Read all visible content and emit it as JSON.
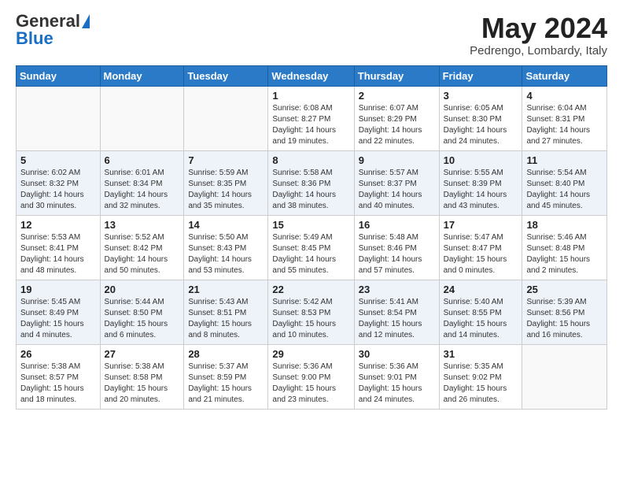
{
  "header": {
    "logo_general": "General",
    "logo_blue": "Blue",
    "month_title": "May 2024",
    "location": "Pedrengo, Lombardy, Italy"
  },
  "weekdays": [
    "Sunday",
    "Monday",
    "Tuesday",
    "Wednesday",
    "Thursday",
    "Friday",
    "Saturday"
  ],
  "weeks": [
    [
      {
        "day": "",
        "info": ""
      },
      {
        "day": "",
        "info": ""
      },
      {
        "day": "",
        "info": ""
      },
      {
        "day": "1",
        "info": "Sunrise: 6:08 AM\nSunset: 8:27 PM\nDaylight: 14 hours\nand 19 minutes."
      },
      {
        "day": "2",
        "info": "Sunrise: 6:07 AM\nSunset: 8:29 PM\nDaylight: 14 hours\nand 22 minutes."
      },
      {
        "day": "3",
        "info": "Sunrise: 6:05 AM\nSunset: 8:30 PM\nDaylight: 14 hours\nand 24 minutes."
      },
      {
        "day": "4",
        "info": "Sunrise: 6:04 AM\nSunset: 8:31 PM\nDaylight: 14 hours\nand 27 minutes."
      }
    ],
    [
      {
        "day": "5",
        "info": "Sunrise: 6:02 AM\nSunset: 8:32 PM\nDaylight: 14 hours\nand 30 minutes."
      },
      {
        "day": "6",
        "info": "Sunrise: 6:01 AM\nSunset: 8:34 PM\nDaylight: 14 hours\nand 32 minutes."
      },
      {
        "day": "7",
        "info": "Sunrise: 5:59 AM\nSunset: 8:35 PM\nDaylight: 14 hours\nand 35 minutes."
      },
      {
        "day": "8",
        "info": "Sunrise: 5:58 AM\nSunset: 8:36 PM\nDaylight: 14 hours\nand 38 minutes."
      },
      {
        "day": "9",
        "info": "Sunrise: 5:57 AM\nSunset: 8:37 PM\nDaylight: 14 hours\nand 40 minutes."
      },
      {
        "day": "10",
        "info": "Sunrise: 5:55 AM\nSunset: 8:39 PM\nDaylight: 14 hours\nand 43 minutes."
      },
      {
        "day": "11",
        "info": "Sunrise: 5:54 AM\nSunset: 8:40 PM\nDaylight: 14 hours\nand 45 minutes."
      }
    ],
    [
      {
        "day": "12",
        "info": "Sunrise: 5:53 AM\nSunset: 8:41 PM\nDaylight: 14 hours\nand 48 minutes."
      },
      {
        "day": "13",
        "info": "Sunrise: 5:52 AM\nSunset: 8:42 PM\nDaylight: 14 hours\nand 50 minutes."
      },
      {
        "day": "14",
        "info": "Sunrise: 5:50 AM\nSunset: 8:43 PM\nDaylight: 14 hours\nand 53 minutes."
      },
      {
        "day": "15",
        "info": "Sunrise: 5:49 AM\nSunset: 8:45 PM\nDaylight: 14 hours\nand 55 minutes."
      },
      {
        "day": "16",
        "info": "Sunrise: 5:48 AM\nSunset: 8:46 PM\nDaylight: 14 hours\nand 57 minutes."
      },
      {
        "day": "17",
        "info": "Sunrise: 5:47 AM\nSunset: 8:47 PM\nDaylight: 15 hours\nand 0 minutes."
      },
      {
        "day": "18",
        "info": "Sunrise: 5:46 AM\nSunset: 8:48 PM\nDaylight: 15 hours\nand 2 minutes."
      }
    ],
    [
      {
        "day": "19",
        "info": "Sunrise: 5:45 AM\nSunset: 8:49 PM\nDaylight: 15 hours\nand 4 minutes."
      },
      {
        "day": "20",
        "info": "Sunrise: 5:44 AM\nSunset: 8:50 PM\nDaylight: 15 hours\nand 6 minutes."
      },
      {
        "day": "21",
        "info": "Sunrise: 5:43 AM\nSunset: 8:51 PM\nDaylight: 15 hours\nand 8 minutes."
      },
      {
        "day": "22",
        "info": "Sunrise: 5:42 AM\nSunset: 8:53 PM\nDaylight: 15 hours\nand 10 minutes."
      },
      {
        "day": "23",
        "info": "Sunrise: 5:41 AM\nSunset: 8:54 PM\nDaylight: 15 hours\nand 12 minutes."
      },
      {
        "day": "24",
        "info": "Sunrise: 5:40 AM\nSunset: 8:55 PM\nDaylight: 15 hours\nand 14 minutes."
      },
      {
        "day": "25",
        "info": "Sunrise: 5:39 AM\nSunset: 8:56 PM\nDaylight: 15 hours\nand 16 minutes."
      }
    ],
    [
      {
        "day": "26",
        "info": "Sunrise: 5:38 AM\nSunset: 8:57 PM\nDaylight: 15 hours\nand 18 minutes."
      },
      {
        "day": "27",
        "info": "Sunrise: 5:38 AM\nSunset: 8:58 PM\nDaylight: 15 hours\nand 20 minutes."
      },
      {
        "day": "28",
        "info": "Sunrise: 5:37 AM\nSunset: 8:59 PM\nDaylight: 15 hours\nand 21 minutes."
      },
      {
        "day": "29",
        "info": "Sunrise: 5:36 AM\nSunset: 9:00 PM\nDaylight: 15 hours\nand 23 minutes."
      },
      {
        "day": "30",
        "info": "Sunrise: 5:36 AM\nSunset: 9:01 PM\nDaylight: 15 hours\nand 24 minutes."
      },
      {
        "day": "31",
        "info": "Sunrise: 5:35 AM\nSunset: 9:02 PM\nDaylight: 15 hours\nand 26 minutes."
      },
      {
        "day": "",
        "info": ""
      }
    ]
  ]
}
